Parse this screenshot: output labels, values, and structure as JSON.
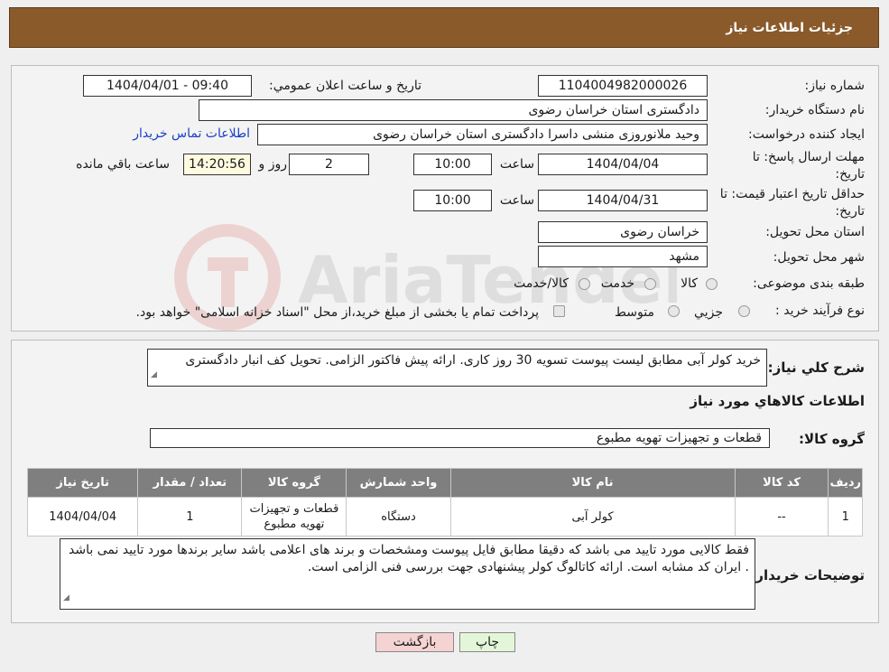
{
  "title": "جزئیات اطلاعات نیاز",
  "labels": {
    "need_number": "شماره نیاز:",
    "announce_datetime": "تاریخ و ساعت اعلان عمومي:",
    "buyer_org": "نام دستگاه خریدار:",
    "requester": "ایجاد کننده درخواست:",
    "contact_link": "اطلاعات تماس خریدار",
    "reply_deadline": "مهلت ارسال پاسخ: تا تاریخ:",
    "time": "ساعت",
    "days": "روز و",
    "remaining": "ساعت باقي مانده",
    "price_validity": "حداقل تاریخ اعتبار قیمت: تا تاریخ:",
    "province": "استان محل تحویل:",
    "city": "شهر محل تحویل:",
    "category": "طبقه بندی موضوعی:",
    "process_type": "نوع فرآیند خرید :",
    "general_desc": "شرح کلي نیاز:",
    "items_info": "اطلاعات کالاهاي مورد نیاز",
    "goods_group": "گروه کالا:",
    "buyer_notes": "توضیحات خریدار:"
  },
  "values": {
    "need_number": "1104004982000026",
    "announce_datetime": "1404/04/01 - 09:40",
    "buyer_org": "دادگستری استان خراسان رضوی",
    "requester": "وحید ملانوروزی منشی داسرا دادگستری استان خراسان رضوی",
    "reply_date": "1404/04/04",
    "reply_time": "10:00",
    "days_remaining": "2",
    "time_remaining": "14:20:56",
    "validity_date": "1404/04/31",
    "validity_time": "10:00",
    "province": "خراسان رضوی",
    "city": "مشهد",
    "general_desc": "خرید کولر آبی مطابق لیست پیوست تسویه 30 روز کاری.  ارائه پیش فاکتور الزامی. تحویل کف انبار دادگستری",
    "goods_group": "قطعات و تجهیزات تهویه مطبوع",
    "buyer_notes": "فقط کالایی مورد تایید می باشد که دقیقا مطابق فایل پیوست ومشخصات و برند های اعلامی باشد سایر برندها مورد تایید نمی باشد . ایران کد مشابه است. ارائه کاتالوگ کولر پیشنهادی جهت بررسی فنی الزامی است."
  },
  "category_options": [
    "کالا",
    "خدمت",
    "کالا/خدمت"
  ],
  "process_options": [
    "جزیي",
    "متوسط"
  ],
  "process_note": "پرداخت تمام یا بخشی از مبلغ خرید،از محل \"اسناد خزانه اسلامی\" خواهد بود.",
  "table": {
    "headers": [
      "ردیف",
      "کد کالا",
      "نام کالا",
      "واحد شمارش",
      "گروه کالا",
      "تعداد / مقدار",
      "تاریخ نیاز"
    ],
    "rows": [
      [
        "1",
        "--",
        "کولر آبی",
        "دستگاه",
        "قطعات و تجهیزات تهویه مطبوع",
        "1",
        "1404/04/04"
      ]
    ]
  },
  "buttons": {
    "print": "چاپ",
    "back": "بازگشت"
  },
  "colors": {
    "title_bar": "#8b5a2b",
    "back_button": "#f6d3d3",
    "print_button": "#e3f7d8",
    "link": "#1a3fc4"
  }
}
